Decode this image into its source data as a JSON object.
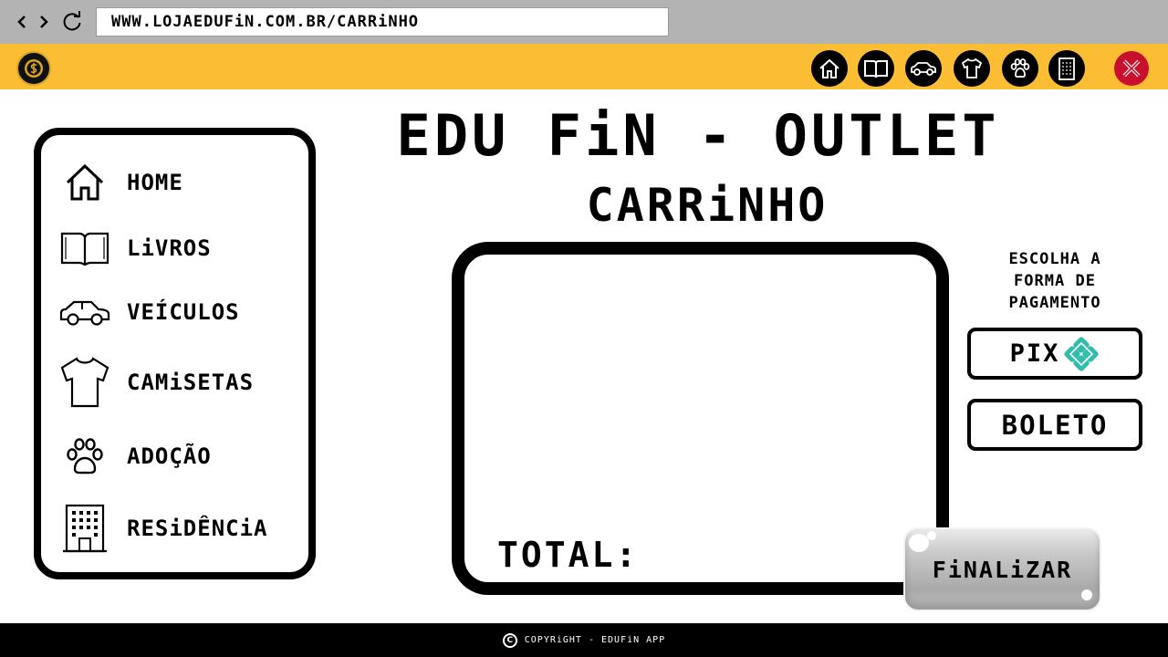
{
  "browser": {
    "url": "WWW.LOJAEDUFiN.COM.BR/CARRiNHO",
    "icons": [
      "back-icon",
      "forward-icon",
      "reload-icon"
    ]
  },
  "top_nav": {
    "logo": "edufin-coin-logo",
    "icons": [
      "home-icon",
      "book-icon",
      "car-icon",
      "shirt-icon",
      "paw-icon",
      "building-icon"
    ],
    "close_icon": "close-icon",
    "colors": {
      "bar": "#fbbd33",
      "close": "#c8102e"
    }
  },
  "sidebar": {
    "items": [
      {
        "label": "HOME",
        "icon": "home-icon"
      },
      {
        "label": "LiVROS",
        "icon": "book-icon"
      },
      {
        "label": "VEÍCULOS",
        "icon": "car-icon"
      },
      {
        "label": "CAMiSETAS",
        "icon": "shirt-icon"
      },
      {
        "label": "ADOÇÃO",
        "icon": "paw-icon"
      },
      {
        "label": "RESiDÊNCiA",
        "icon": "building-icon"
      }
    ]
  },
  "main": {
    "title": "EDU FiN - OUTLET",
    "subtitle": "CARRiNHO",
    "total_label": "TOTAL:"
  },
  "payment": {
    "heading_lines": [
      "ESCOLHA A",
      "FORMA DE",
      "PAGAMENTO"
    ],
    "pix_label": "PIX",
    "pix_color": "#32bcad",
    "boleto_label": "BOLETO"
  },
  "finalize": {
    "label": "FiNALiZAR"
  },
  "footer": {
    "copyright_symbol": "C",
    "text": "COPYRiGHT - EDUFiN APP"
  }
}
